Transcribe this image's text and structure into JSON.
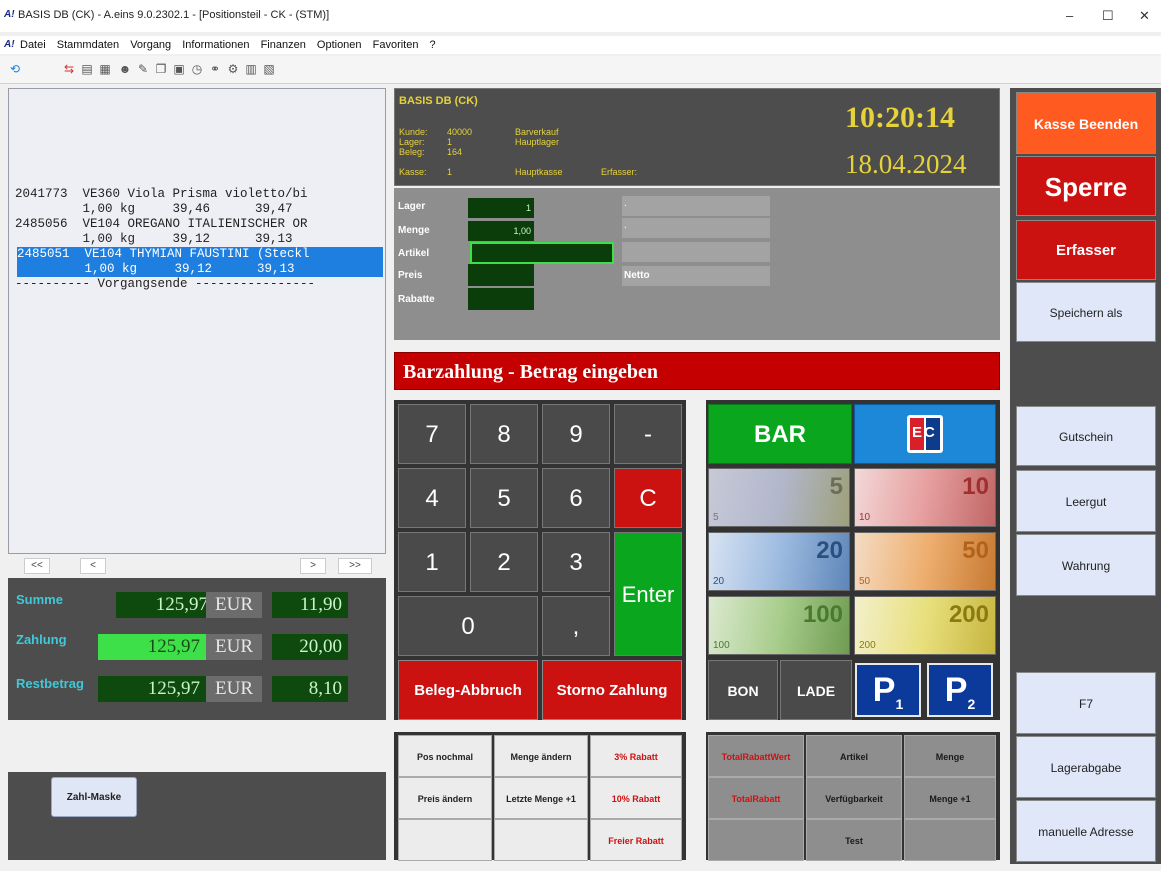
{
  "window": {
    "title": "BASIS DB (CK) - A.eins 9.0.2302.1 - [Positionsteil - CK - (STM)]",
    "minimize": "–",
    "maximize": "☐",
    "close": "✕",
    "app_logo": "A!"
  },
  "menu": [
    "Datei",
    "Stammdaten",
    "Vorgang",
    "Informationen",
    "Finanzen",
    "Optionen",
    "Favoriten",
    "?"
  ],
  "toolbar_icons": [
    "refresh-icon",
    "arrows-icon",
    "printer-icon",
    "doc-icon",
    "user-icon",
    "edit-icon",
    "copy-icon",
    "calc-icon",
    "clock-icon",
    "link-icon",
    "gear-icon",
    "grid-icon",
    "save-icon"
  ],
  "positions": [
    {
      "line1": "2041773  VE360 Viola Prisma violetto/bi",
      "line2": "         1,00 kg     39,46      39,47",
      "selected": false
    },
    {
      "line1": "2485056  VE104 OREGANO ITALIENISCHER OR",
      "line2": "         1,00 kg     39,12      39,13",
      "selected": false
    },
    {
      "line1": "2485051  VE104 THYMIAN FAUSTINI (Steckl",
      "line2": "         1,00 kg     39,12      39,13",
      "selected": true
    },
    {
      "line1": "---------- Vorgangsende ----------------",
      "line2": "",
      "selected": false
    }
  ],
  "nav": {
    "first": "<<",
    "prev": "<",
    "next": ">",
    "last": ">>"
  },
  "summary": [
    {
      "label": "Summe",
      "amount": "125,97",
      "currency": "EUR",
      "extra": "11,90"
    },
    {
      "label": "Zahlung",
      "amount": "125,97",
      "currency": "EUR",
      "extra": "20,00"
    },
    {
      "label": "Restbetrag",
      "amount": "125,97",
      "currency": "EUR",
      "extra": "8,10"
    }
  ],
  "zahl_maske": "Zahl-Maske",
  "header": {
    "db": "BASIS DB (CK)",
    "time": "10:20:14",
    "date": "18.04.2024",
    "kunde_label": "Kunde:",
    "kunde": "40000",
    "kunde_name": "Barverkauf",
    "lager_label": "Lager:",
    "lager": "1",
    "lager_name": "Hauptlager",
    "beleg_label": "Beleg:",
    "beleg": "164",
    "kasse_label": "Kasse:",
    "kasse": "1",
    "kasse_name": "Hauptkasse",
    "erfasser_label": "Erfasser:"
  },
  "form": {
    "lager_label": "Lager",
    "lager": "1",
    "menge_label": "Menge",
    "menge": "1,00",
    "artikel_label": "Artikel",
    "preis_label": "Preis",
    "rabatte_label": "Rabatte",
    "netto_label": "Netto",
    "dot1": ".",
    "dot2": "."
  },
  "pay_prompt": "Barzahlung - Betrag eingeben",
  "keys": {
    "k7": "7",
    "k8": "8",
    "k9": "9",
    "minus": "-",
    "k4": "4",
    "k5": "5",
    "k6": "6",
    "c": "C",
    "k1": "1",
    "k2": "2",
    "k3": "3",
    "enter": "Enter",
    "k0": "0",
    "comma": ","
  },
  "beleg_abbruch": "Beleg-Abbruch",
  "storno_zahlung": "Storno Zahlung",
  "pay": {
    "bar": "BAR",
    "ec": "EC",
    "notes": [
      "5",
      "10",
      "20",
      "50",
      "100",
      "200"
    ],
    "bon": "BON",
    "lade": "LADE",
    "p1": "P",
    "p1sub": "1",
    "p2": "P",
    "p2sub": "2"
  },
  "fkeys_left": [
    "Pos nochmal",
    "Menge ändern",
    "3% Rabatt",
    "Preis ändern",
    "Letzte Menge +1",
    "10% Rabatt",
    "",
    "",
    "Freier Rabatt"
  ],
  "fkeys_right": [
    "TotalRabattWert",
    "Artikel",
    "Menge",
    "TotalRabatt",
    "Verfügbarkeit",
    "Menge +1",
    "",
    "Test",
    ""
  ],
  "right": {
    "kasse_beenden": "Kasse Beenden",
    "sperre": "Sperre",
    "erfasser": "Erfasser",
    "speichern_als": "Speichern als",
    "gutschein": "Gutschein",
    "leergut": "Leergut",
    "wahrung": "Wahrung",
    "f7": "F7",
    "lagerabgabe": "Lagerabgabe",
    "manuelle_adresse": "manuelle Adresse"
  },
  "colors": {
    "red": "#cc1111",
    "green": "#0aa61e",
    "dark": "#4d4d4d",
    "blue": "#1e7fe0",
    "orange": "#ff5a1f"
  }
}
